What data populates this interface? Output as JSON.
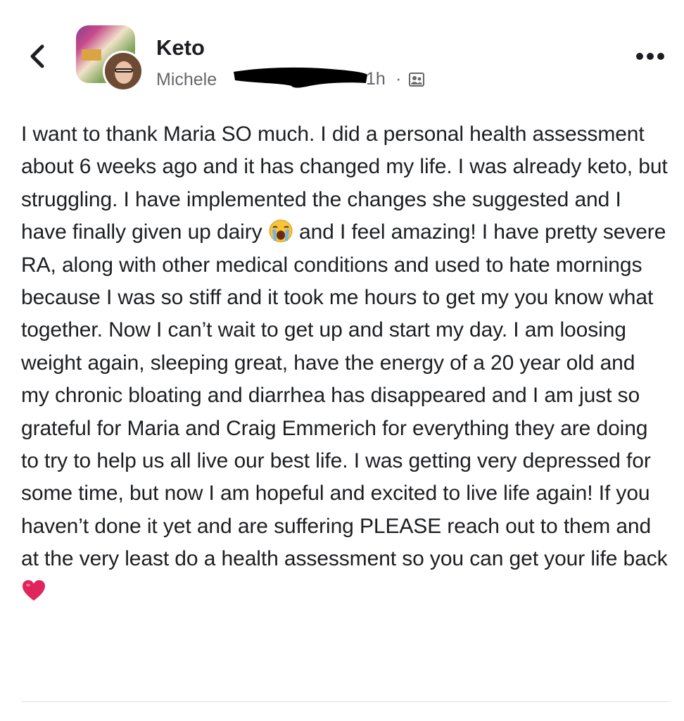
{
  "header": {
    "group_name": "Keto",
    "author_visible": "Michele",
    "time": "1h",
    "separator": "·",
    "icons": {
      "back": "chevron-left-icon",
      "privacy": "members-icon",
      "more": "more-dots-icon"
    }
  },
  "post": {
    "text_part1": "I want to thank Maria SO much. I did a personal health assessment about 6 weeks ago and it has changed my life. I was already keto, but struggling. I have implemented the changes she suggested and I have finally given up dairy ",
    "emoji1": "crying-face-emoji",
    "text_part2": " and I feel amazing! I have pretty severe RA, along with other medical conditions and used to hate mornings because I was so stiff and it took me hours to get my you know what together. Now I can’t wait to get up and start my day. I am loosing weight again, sleeping great, have the energy of a 20 year old and my chronic bloating and diarrhea has disappeared and I am just so grateful for Maria and Craig Emmerich for everything they are doing to try to help us all live our best life. I was getting very depressed for some time, but now I am hopeful and excited to live life again! If you haven’t done it yet and are suffering PLEASE reach out to them and at the very least do a health assessment so you can get your life back ",
    "emoji2": "red-heart-emoji"
  },
  "colors": {
    "text": "#1c1e21",
    "secondary": "#65676b",
    "heart": "#e0245e",
    "divider": "#dcdfe3"
  }
}
